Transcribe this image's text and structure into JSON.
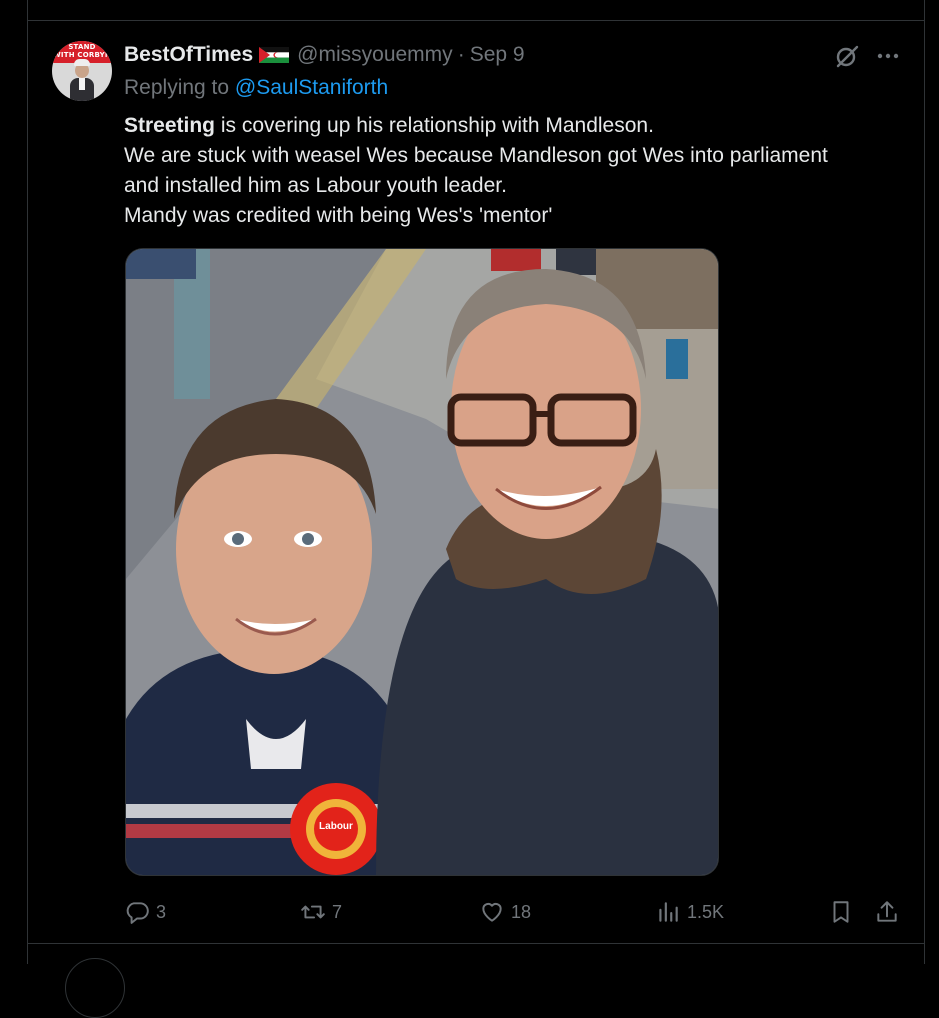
{
  "tweet": {
    "display_name": "BestOfTimes",
    "handle": "@missyouemmy",
    "separator": "·",
    "date": "Sep 9",
    "replying_prefix": "Replying to",
    "replying_to": "@SaulStaniforth",
    "text": {
      "line1_bold": "Streeting",
      "line1_rest": " is covering up his relationship with Mandleson.",
      "line2": "We are stuck with weasel Wes because Mandleson got Wes into parliament",
      "line3": "and installed him as Labour youth leader.",
      "line4": "Mandy was credited with being Wes's 'mentor'"
    },
    "avatar": {
      "line1": "STAND",
      "line2": "WITH CORBYN"
    },
    "flag_icon": "western-sahara-flag-icon",
    "media_badge": "Labour",
    "stats": {
      "replies": "3",
      "reposts": "7",
      "likes": "18",
      "views": "1.5K"
    }
  },
  "icons": {
    "grok": "grok-icon",
    "more": "more-icon",
    "reply": "reply-icon",
    "repost": "repost-icon",
    "like": "heart-icon",
    "views": "views-icon",
    "bookmark": "bookmark-icon",
    "share": "share-icon"
  },
  "colors": {
    "background": "#000000",
    "text": "#e7e9ea",
    "muted": "#71767b",
    "link": "#1d9bf0",
    "border": "#2f3336",
    "rosette": "#e2231a"
  }
}
